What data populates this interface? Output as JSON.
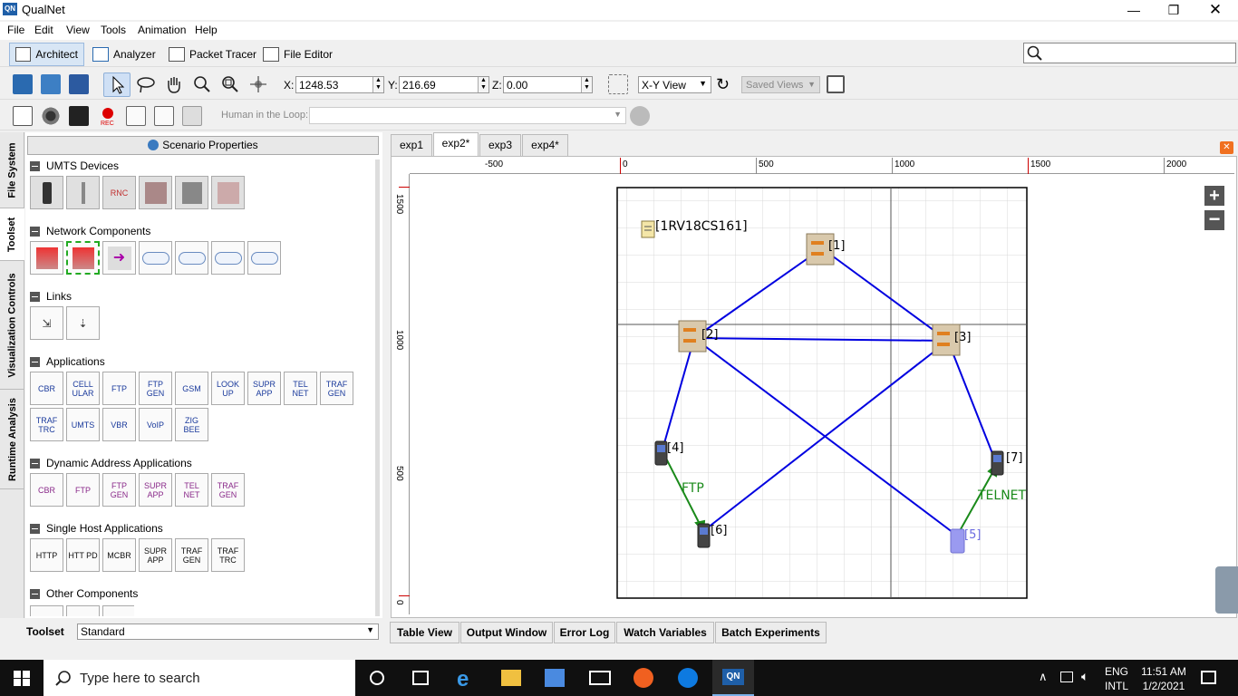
{
  "window": {
    "title": "QualNet",
    "logo": "QN"
  },
  "menu": [
    "File",
    "Edit",
    "View",
    "Tools",
    "Animation",
    "Help"
  ],
  "modes": [
    {
      "label": "Architect",
      "active": true
    },
    {
      "label": "Analyzer"
    },
    {
      "label": "Packet Tracer"
    },
    {
      "label": "File Editor"
    }
  ],
  "coords": {
    "x_label": "X:",
    "x": "1248.53",
    "y_label": "Y:",
    "y": "216.69",
    "z_label": "Z:",
    "z": "0.00",
    "view": "X-Y View",
    "saved_views": "Saved Views"
  },
  "hitl": {
    "label": "Human in the Loop:",
    "value": ""
  },
  "side_tabs": [
    "File System",
    "Toolset",
    "Visualization Controls",
    "Runtime Analysis"
  ],
  "scenario_properties": "Scenario Properties",
  "sections": {
    "umts": {
      "title": "UMTS Devices",
      "tiles": [
        "",
        "",
        "RNC",
        "",
        "",
        ""
      ]
    },
    "network": {
      "title": "Network Components"
    },
    "links": {
      "title": "Links"
    },
    "applications": {
      "title": "Applications",
      "tiles": [
        "CBR",
        "CELL ULAR",
        "FTP",
        "FTP GEN",
        "GSM",
        "LOOK UP",
        "SUPR APP",
        "TEL NET",
        "TRAF GEN",
        "TRAF TRC",
        "UMTS",
        "VBR",
        "VoIP",
        "ZIG BEE"
      ]
    },
    "dynamic": {
      "title": "Dynamic Address Applications",
      "tiles": [
        "CBR",
        "FTP",
        "FTP GEN",
        "SUPR APP",
        "TEL NET",
        "TRAF GEN"
      ]
    },
    "single": {
      "title": "Single Host Applications",
      "tiles": [
        "HTTP",
        "HTT PD",
        "MCBR",
        "SUPR APP",
        "TRAF GEN",
        "TRAF TRC"
      ]
    },
    "other": {
      "title": "Other Components"
    }
  },
  "toolset": {
    "label": "Toolset",
    "value": "Standard"
  },
  "doc_tabs": [
    "exp1",
    "exp2*",
    "exp3",
    "exp4*"
  ],
  "ruler": {
    "h": [
      "-500",
      "0",
      "500",
      "1000",
      "1500",
      "2000"
    ],
    "v": [
      "1500",
      "1000",
      "500",
      "0"
    ]
  },
  "canvas": {
    "note": "[1RV18CS161]",
    "nodes": [
      {
        "id": "[1]",
        "kind": "router"
      },
      {
        "id": "[2]",
        "kind": "router"
      },
      {
        "id": "[3]",
        "kind": "router"
      },
      {
        "id": "[4]",
        "kind": "phone"
      },
      {
        "id": "[5]",
        "kind": "phone-faded"
      },
      {
        "id": "[6]",
        "kind": "phone"
      },
      {
        "id": "[7]",
        "kind": "phone"
      }
    ],
    "app_labels": [
      "FTP",
      "TELNET"
    ],
    "colors": {
      "link": "#0000e0",
      "app": "#1a8a1a",
      "border": "#000000"
    }
  },
  "bottom_tabs": [
    "Table View",
    "Output Window",
    "Error Log",
    "Watch Variables",
    "Batch Experiments"
  ],
  "taskbar": {
    "search": "Type here to search",
    "lang1": "ENG",
    "lang2": "INTL",
    "time": "11:51 AM",
    "date": "1/2/2021"
  }
}
